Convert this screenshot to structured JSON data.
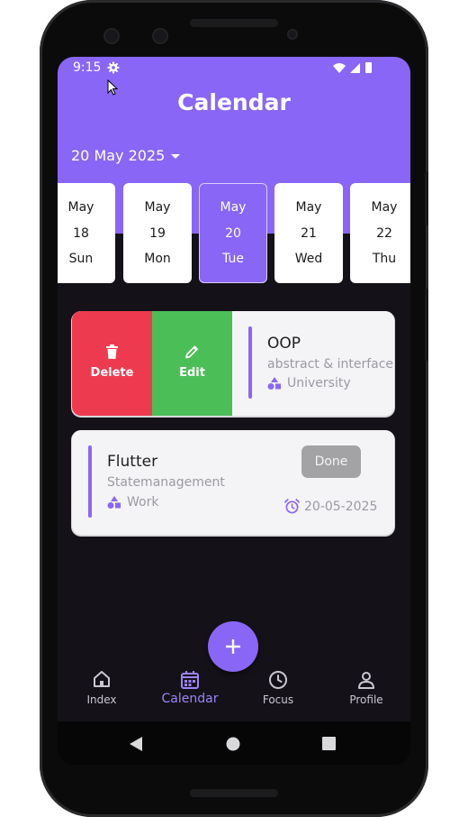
{
  "status": {
    "time": "9:15"
  },
  "header": {
    "title": "Calendar",
    "selected_date": "20 May 2025"
  },
  "days": [
    {
      "month": "May",
      "day": "18",
      "weekday": "Sun",
      "selected": false
    },
    {
      "month": "May",
      "day": "19",
      "weekday": "Mon",
      "selected": false
    },
    {
      "month": "May",
      "day": "20",
      "weekday": "Tue",
      "selected": true
    },
    {
      "month": "May",
      "day": "21",
      "weekday": "Wed",
      "selected": false
    },
    {
      "month": "May",
      "day": "22",
      "weekday": "Thu",
      "selected": false
    }
  ],
  "tasks": [
    {
      "title": "OOP",
      "description": "abstract & interface",
      "category": "University",
      "actions": {
        "delete": "Delete",
        "edit": "Edit"
      }
    },
    {
      "title": "Flutter",
      "description": "Statemanagement",
      "category": "Work",
      "done_label": "Done",
      "due": "20-05-2025"
    }
  ],
  "nav": {
    "items": [
      "Index",
      "Calendar",
      "Focus",
      "Profile"
    ],
    "active": "Calendar"
  },
  "colors": {
    "accent": "#8a66f6",
    "delete": "#ee3a4f",
    "edit": "#4cbe58",
    "background": "#141218",
    "card": "#f4f3f6"
  },
  "icons": [
    "gear-icon",
    "wifi-icon",
    "signal-icon",
    "battery-icon",
    "dropdown-arrow-icon",
    "trash-icon",
    "pencil-icon",
    "category-shapes-icon",
    "alarm-clock-icon",
    "plus-icon",
    "home-icon",
    "calendar-icon",
    "clock-icon",
    "person-icon",
    "back-triangle-icon",
    "home-circle-icon",
    "recents-square-icon"
  ]
}
